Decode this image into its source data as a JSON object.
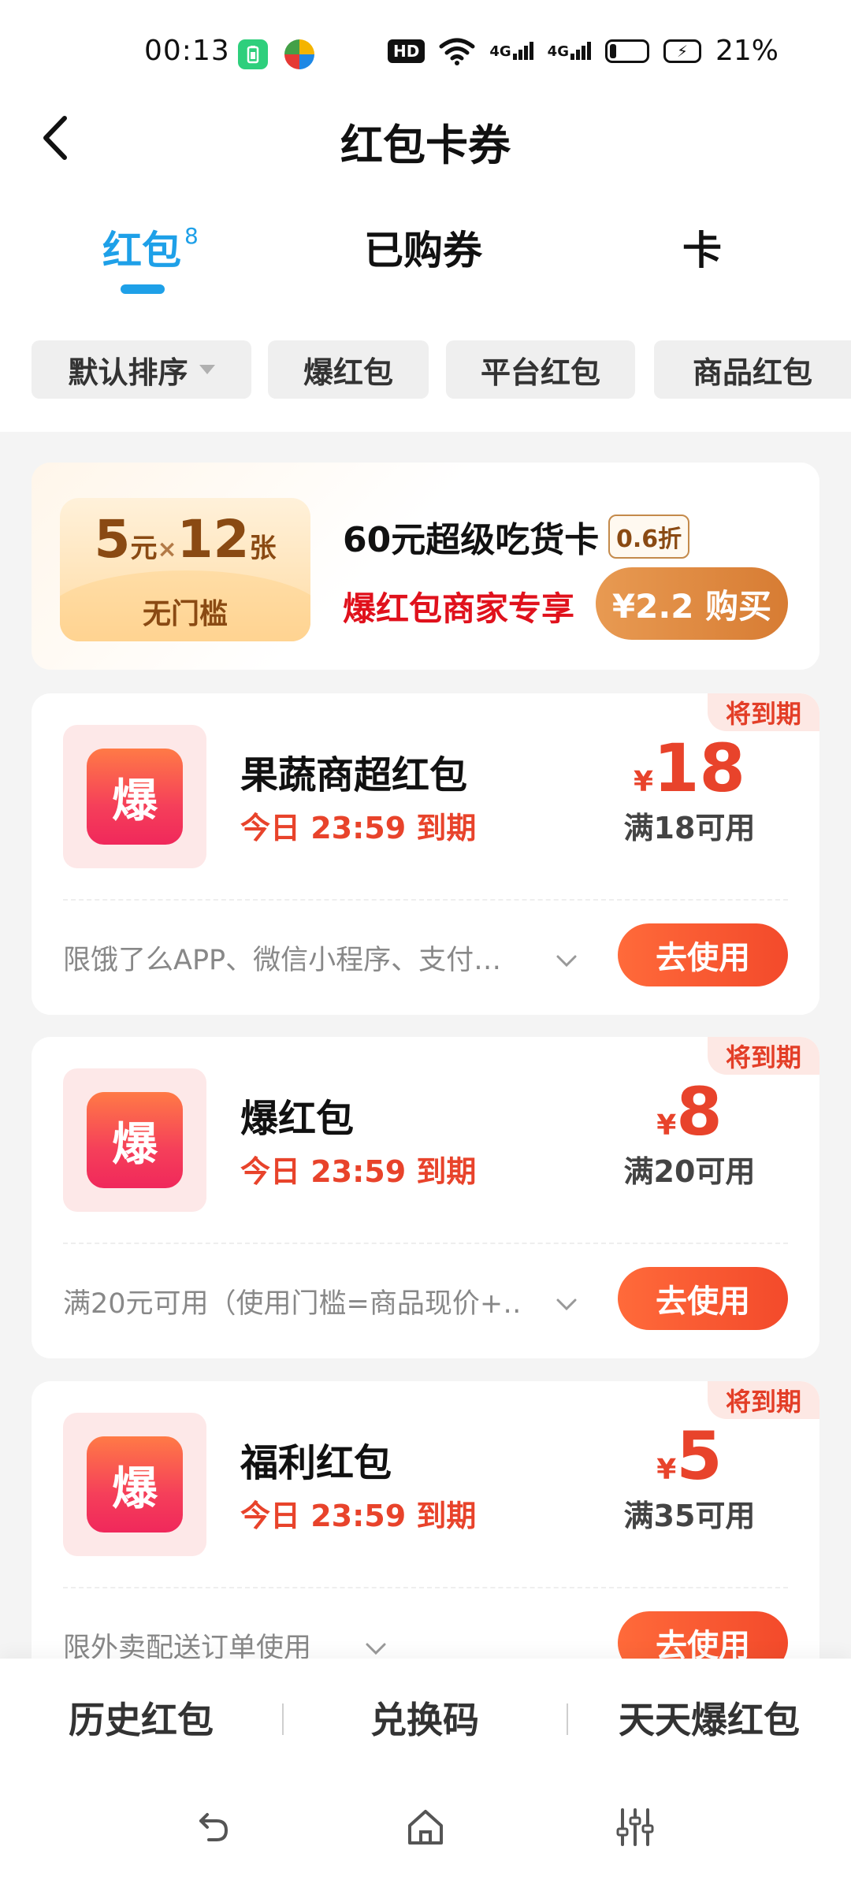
{
  "status_bar": {
    "time": "00:13",
    "hd_badge": "HD",
    "network1": "4G",
    "network2": "4G",
    "battery": "21%"
  },
  "header": {
    "back_icon": "chevron-left-icon",
    "title": "红包卡券"
  },
  "tabs": [
    {
      "label": "红包",
      "badge": "8",
      "active": true
    },
    {
      "label": "已购券",
      "active": false
    },
    {
      "label": "卡",
      "active": false
    }
  ],
  "filters": [
    {
      "label": "默认排序",
      "dropdown": true
    },
    {
      "label": "爆红包"
    },
    {
      "label": "平台红包"
    },
    {
      "label": "商品红包"
    }
  ],
  "promo": {
    "amount": "5",
    "amount_unit": "元",
    "times": "×",
    "count": "12",
    "count_unit": "张",
    "threshold": "无门槛",
    "title": "60元超级吃货卡",
    "discount": "0.6折",
    "subtitle": "爆红包商家专享",
    "buy_label": "¥2.2 购买"
  },
  "coupons": [
    {
      "expire_tag": "将到期",
      "icon_char": "爆",
      "name": "果蔬商超红包",
      "expiry": "今日 23:59 到期",
      "currency": "¥",
      "amount": "18",
      "condition": "满18可用",
      "description": "限饿了么APP、微信小程序、支付…",
      "use_label": "去使用"
    },
    {
      "expire_tag": "将到期",
      "icon_char": "爆",
      "name": "爆红包",
      "expiry": "今日 23:59 到期",
      "currency": "¥",
      "amount": "8",
      "condition": "满20可用",
      "description": "满20元可用（使用门槛=商品现价+…",
      "use_label": "去使用"
    },
    {
      "expire_tag": "将到期",
      "icon_char": "爆",
      "name": "福利红包",
      "expiry": "今日 23:59 到期",
      "currency": "¥",
      "amount": "5",
      "condition": "满35可用",
      "description": "限外卖配送订单使用",
      "use_label": "去使用"
    }
  ],
  "bottom_bar": [
    {
      "label": "历史红包"
    },
    {
      "label": "兑换码"
    },
    {
      "label": "天天爆红包"
    }
  ],
  "nav_bar": {
    "back_icon": "back-gesture-icon",
    "home_icon": "home-icon",
    "menu_icon": "sliders-icon"
  },
  "colors": {
    "accent_blue": "#1ea0e8",
    "red": "#e8432b",
    "promo_brown": "#8a4a13"
  }
}
